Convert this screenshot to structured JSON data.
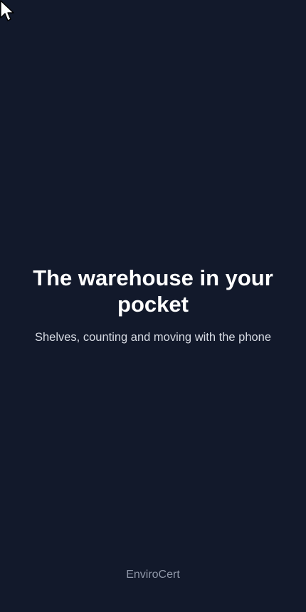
{
  "hero": {
    "title": "The warehouse in your pocket",
    "subtitle": "Shelves, counting and moving with the phone"
  },
  "footer": {
    "brand": "EnviroCert"
  },
  "icons": {
    "cursor": "mouse-pointer-icon"
  },
  "colors": {
    "background": "#12192b",
    "title": "#ffffff",
    "subtitle": "#d7dbe3",
    "brand": "#8f97a8"
  }
}
